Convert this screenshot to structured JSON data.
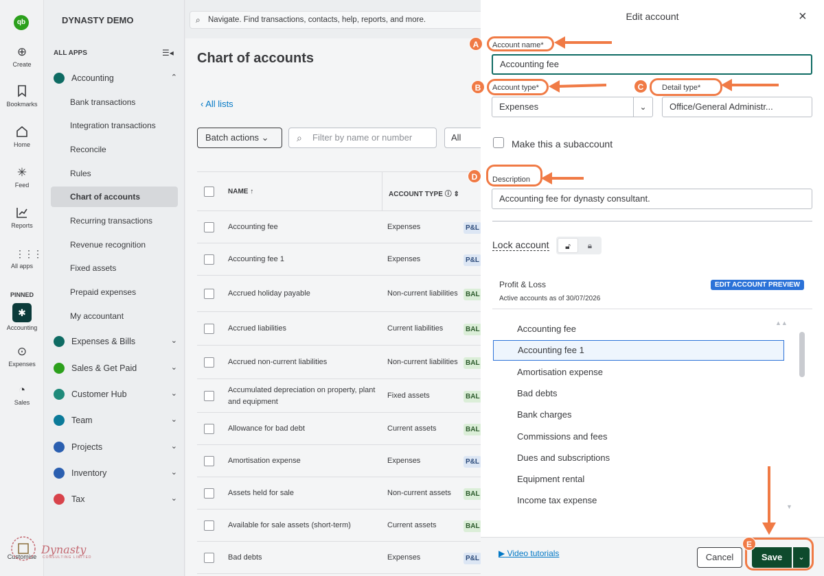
{
  "rail": {
    "logo": "qb",
    "items": [
      {
        "icon": "plus-circle-icon",
        "label": "Create"
      },
      {
        "icon": "bookmark-icon",
        "label": "Bookmarks"
      },
      {
        "icon": "home-icon",
        "label": "Home"
      },
      {
        "icon": "feed-icon",
        "label": "Feed"
      },
      {
        "icon": "chart-icon",
        "label": "Reports"
      },
      {
        "icon": "grid-icon",
        "label": "All apps"
      }
    ],
    "pinned_label": "PINNED",
    "pinned": [
      {
        "icon": "accounting-icon",
        "label": "Accounting"
      },
      {
        "icon": "expenses-icon",
        "label": "Expenses"
      },
      {
        "icon": "sales-icon",
        "label": "Sales"
      }
    ],
    "customise": "Customise"
  },
  "nav": {
    "company": "DYNASTY DEMO",
    "all_apps": "ALL APPS",
    "accounting": "Accounting",
    "sub_items": [
      "Bank transactions",
      "Integration transactions",
      "Reconcile",
      "Rules",
      "Chart of accounts",
      "Recurring transactions",
      "Revenue recognition",
      "Fixed assets",
      "Prepaid expenses",
      "My accountant"
    ],
    "active_item": "Chart of accounts",
    "groups": [
      {
        "label": "Expenses & Bills",
        "color": "#0e6b63"
      },
      {
        "label": "Sales & Get Paid",
        "color": "#2ca01c"
      },
      {
        "label": "Customer Hub",
        "color": "#1f8a7a"
      },
      {
        "label": "Team",
        "color": "#0b7a99"
      },
      {
        "label": "Projects",
        "color": "#2b5fb0"
      },
      {
        "label": "Inventory",
        "color": "#2b5fb0"
      },
      {
        "label": "Tax",
        "color": "#d8434b"
      }
    ]
  },
  "search": {
    "placeholder": "Navigate. Find transactions, contacts, help, reports, and more."
  },
  "main": {
    "title": "Chart of accounts",
    "all_lists": "All lists",
    "batch_actions": "Batch actions",
    "filter_placeholder": "Filter by name or number",
    "filter_select": "All",
    "columns": {
      "name": "NAME",
      "account_type": "ACCOUNT TYPE"
    },
    "rows": [
      {
        "name": "Accounting fee",
        "type": "Expenses",
        "badge": "P&L"
      },
      {
        "name": "Accounting fee 1",
        "type": "Expenses",
        "badge": "P&L"
      },
      {
        "name": "Accrued holiday payable",
        "type": "Non-current liabilities",
        "badge": "BAL"
      },
      {
        "name": "Accrued liabilities",
        "type": "Current liabilities",
        "badge": "BAL"
      },
      {
        "name": "Accrued non-current liabilities",
        "type": "Non-current liabilities",
        "badge": "BAL"
      },
      {
        "name": "Accumulated depreciation on property, plant and equipment",
        "type": "Fixed assets",
        "badge": "BAL"
      },
      {
        "name": "Allowance for bad debt",
        "type": "Current assets",
        "badge": "BAL"
      },
      {
        "name": "Amortisation expense",
        "type": "Expenses",
        "badge": "P&L"
      },
      {
        "name": "Assets held for sale",
        "type": "Non-current assets",
        "badge": "BAL"
      },
      {
        "name": "Available for sale assets (short-term)",
        "type": "Current assets",
        "badge": "BAL"
      },
      {
        "name": "Bad debts",
        "type": "Expenses",
        "badge": "P&L"
      }
    ]
  },
  "panel": {
    "title": "Edit account",
    "account_name_label": "Account name*",
    "account_name_value": "Accounting fee",
    "account_type_label": "Account type*",
    "account_type_value": "Expenses",
    "detail_type_label": "Detail type*",
    "detail_type_value": "Office/General Administr...",
    "subaccount_label": "Make this a subaccount",
    "description_label": "Description",
    "description_value": "Accounting fee for dynasty consultant.",
    "lock_label": "Lock account",
    "preview_title": "Profit & Loss",
    "preview_sub": "Active accounts as of 30/07/2026",
    "preview_badge": "EDIT ACCOUNT PREVIEW",
    "preview_items": [
      "Accounting fee",
      "Accounting fee 1",
      "Amortisation expense",
      "Bad debts",
      "Bank charges",
      "Commissions and fees",
      "Dues and subscriptions",
      "Equipment rental",
      "Income tax expense"
    ],
    "preview_highlighted": "Accounting fee 1",
    "video_tutorials": "Video tutorials",
    "cancel": "Cancel",
    "save": "Save"
  },
  "annotations": {
    "markers": [
      "A",
      "B",
      "C",
      "D",
      "E"
    ],
    "color": "#f07a45"
  },
  "watermark": {
    "brand": "Dynasty",
    "sub": "CONSULTING LIMITED"
  }
}
